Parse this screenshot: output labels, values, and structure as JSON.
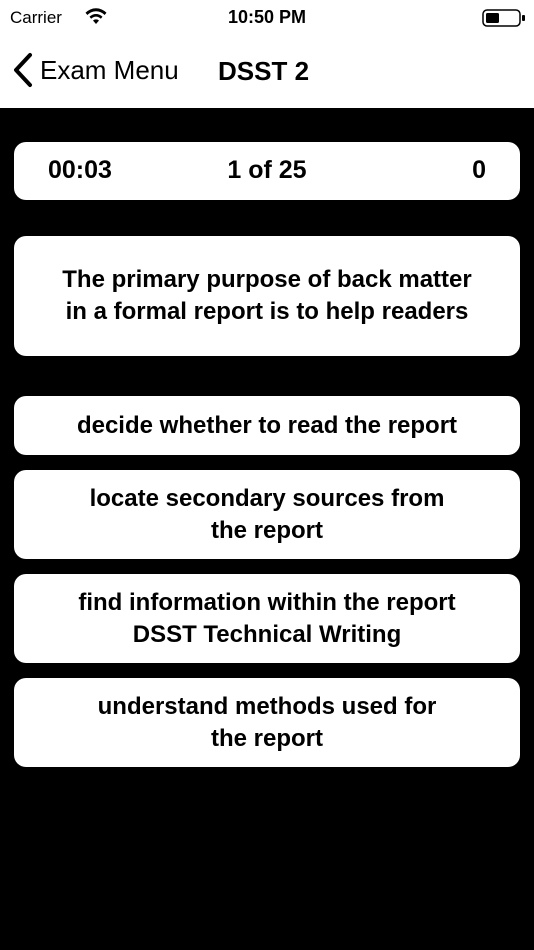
{
  "status_bar": {
    "carrier": "Carrier",
    "time": "10:50 PM"
  },
  "nav": {
    "back_label": "Exam Menu",
    "title": "DSST 2"
  },
  "stats": {
    "timer": "00:03",
    "progress": "1 of 25",
    "score": "0"
  },
  "question": {
    "line1": "The primary purpose of back matter",
    "line2": "in a formal report is to help readers"
  },
  "answers": [
    {
      "line1": "decide whether to read the report",
      "line2": ""
    },
    {
      "line1": "locate secondary sources from",
      "line2": "the report"
    },
    {
      "line1": "find information within the report",
      "line2": "DSST Technical Writing"
    },
    {
      "line1": "understand methods used for",
      "line2": "the report"
    }
  ],
  "icons": {
    "wifi": "wifi-icon",
    "battery": "battery-icon",
    "back": "chevron-left-icon"
  },
  "colors": {
    "background": "#000000",
    "card": "#ffffff",
    "text": "#000000"
  }
}
